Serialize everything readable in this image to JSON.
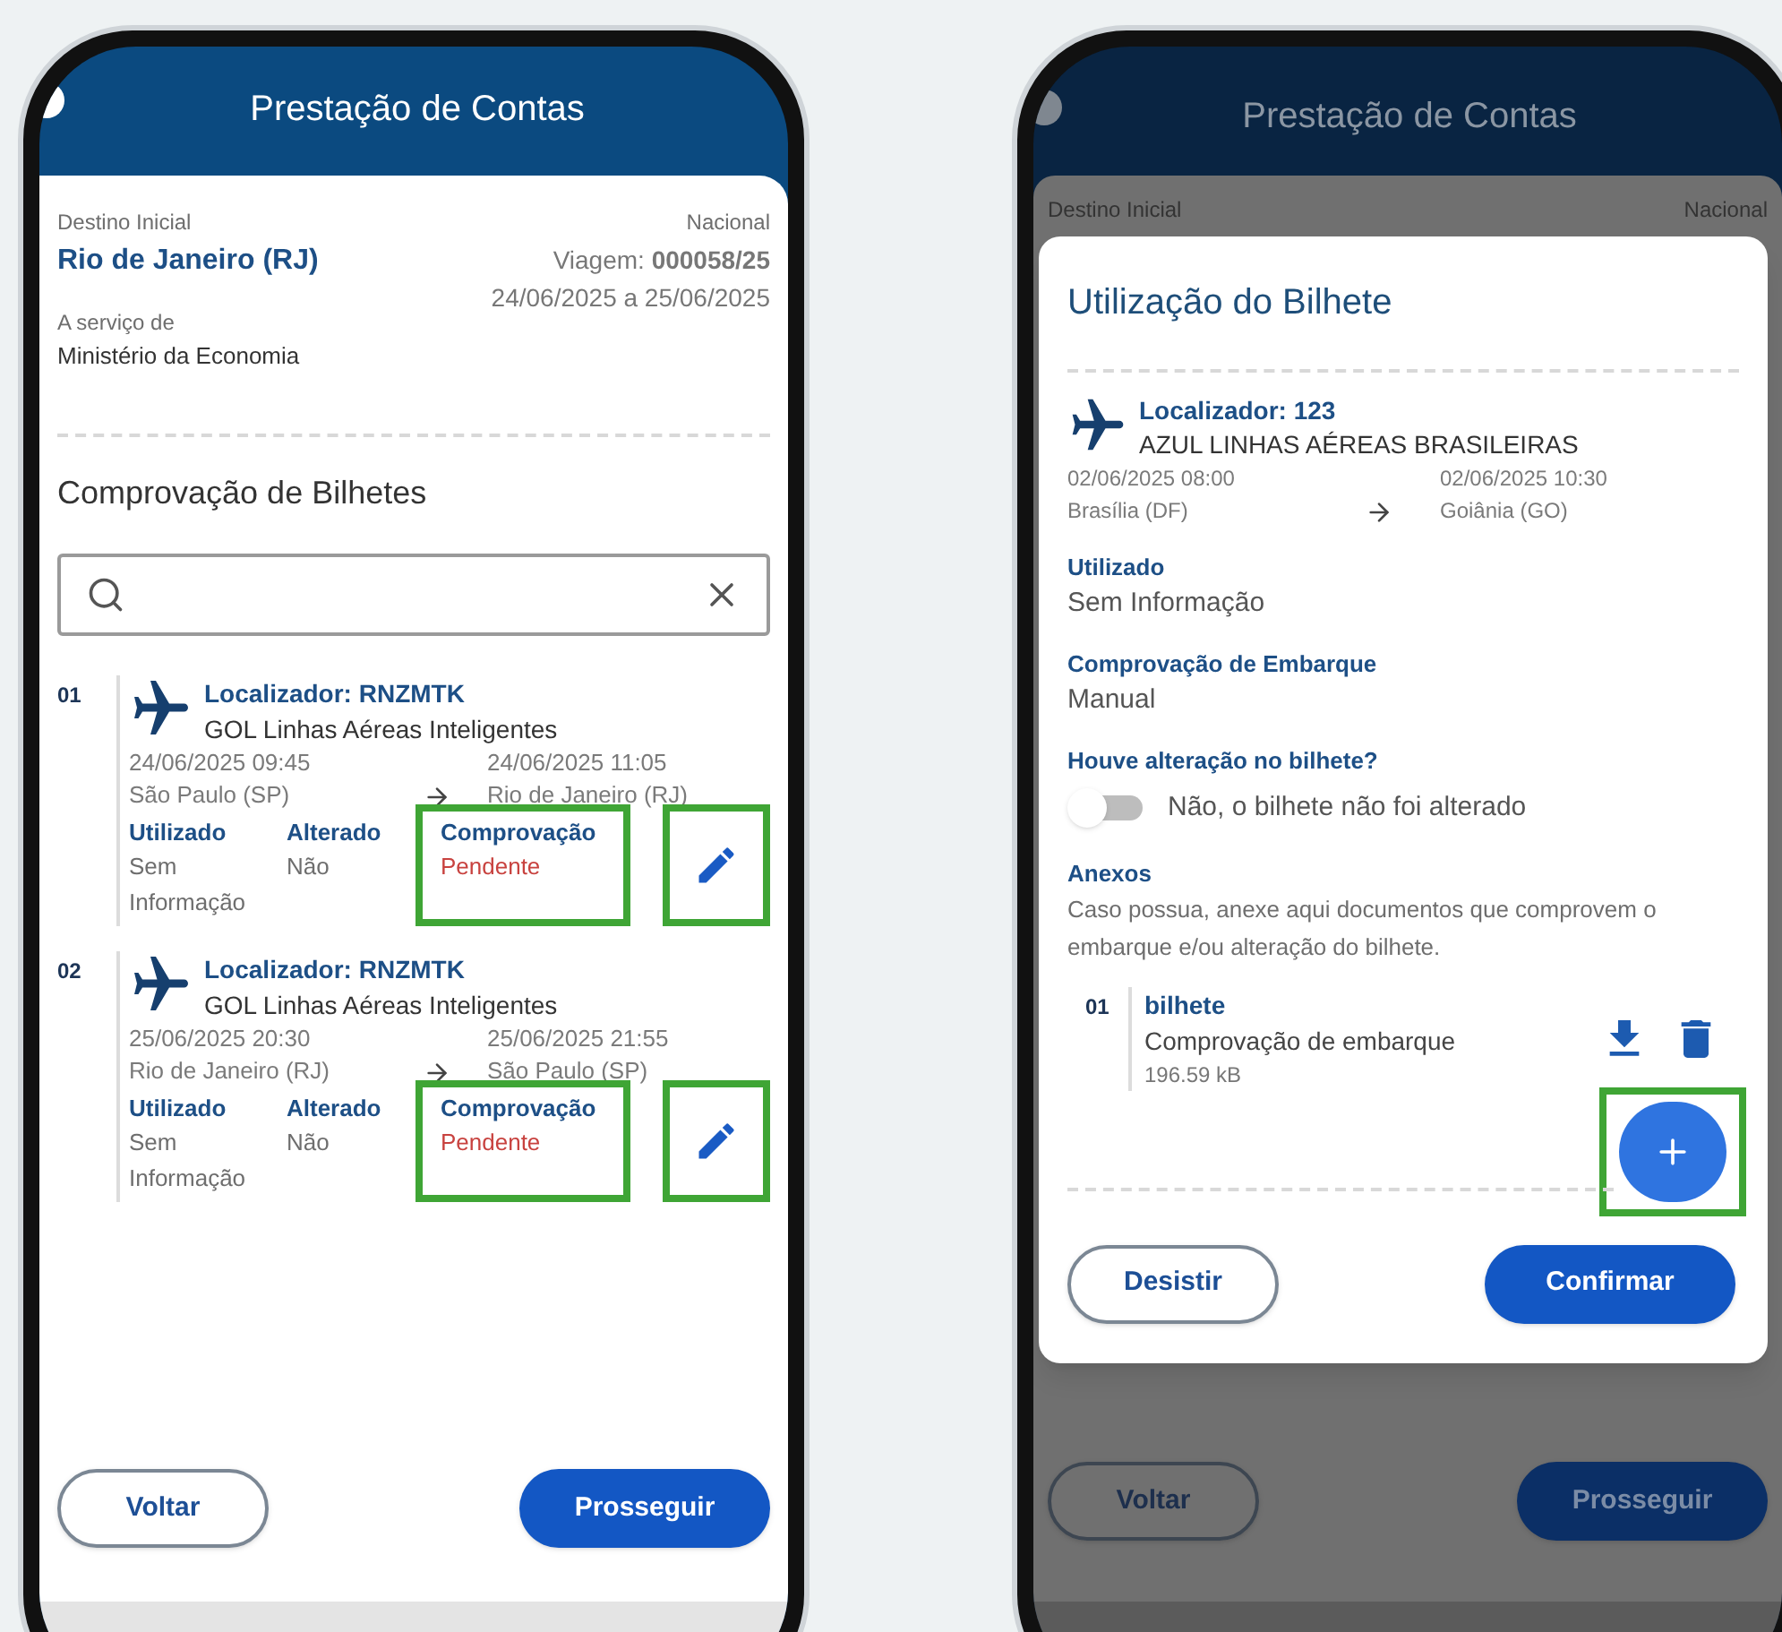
{
  "left_screen": {
    "header_title": "Prestação de Contas",
    "trip": {
      "destination_label": "Destino Inicial",
      "destination": "Rio de Janeiro (RJ)",
      "scope": "Nacional",
      "trip_number": "Viagem: **000058/25**",
      "dates": "24/06/2025 a 25/06/2025",
      "service_label": "A serviço de",
      "service": "Ministério da Economia"
    },
    "section_title": "Comprovação de Bilhetes",
    "tickets": [
      {
        "number": "01",
        "locator": "Localizador: RNZMTK",
        "airline": "GOL Linhas Aéreas Inteligentes",
        "departure": {
          "date": "24/06/2025",
          "time": "09:45",
          "city": "São Paulo (SP)"
        },
        "arrival": {
          "date": "24/06/2025",
          "time": "11:05",
          "city": "Rio de Janeiro (RJ)"
        },
        "columns": [
          {
            "label": "Utilizado",
            "value": "Sem Informação",
            "color": "#6e6e6e",
            "highlighted": false
          },
          {
            "label": "Alterado",
            "value": "Não",
            "color": "#6e6e6e",
            "highlighted": false
          },
          {
            "label": "Comprovação",
            "value": "Pendente",
            "color": "#c8423f",
            "highlighted": true
          }
        ],
        "edit_highlighted": true
      },
      {
        "number": "02",
        "locator": "Localizador: RNZMTK",
        "airline": "GOL Linhas Aéreas Inteligentes",
        "departure": {
          "date": "25/06/2025",
          "time": "20:30",
          "city": "Rio de Janeiro (RJ)"
        },
        "arrival": {
          "date": "25/06/2025",
          "time": "21:55",
          "city": "São Paulo (SP)"
        },
        "columns": [
          {
            "label": "Utilizado",
            "value": "Sem Informação",
            "color": "#6e6e6e",
            "highlighted": false
          },
          {
            "label": "Alterado",
            "value": "Não",
            "color": "#6e6e6e",
            "highlighted": false
          },
          {
            "label": "Comprovação",
            "value": "Pendente",
            "color": "#c8423f",
            "highlighted": true
          }
        ],
        "edit_highlighted": true
      }
    ],
    "buttons": [
      {
        "label": "Voltar",
        "kind": "outline"
      },
      {
        "label": "Prosseguir",
        "kind": "primary"
      }
    ]
  },
  "right_screen": {
    "header_title": "Prestação de Contas",
    "background_labels": [
      "Destino Inicial",
      "Nacional"
    ],
    "modal": {
      "title": "Utilização do Bilhete",
      "ticket": {
        "locator": "Localizador: 123",
        "airline": "AZUL LINHAS AÉREAS BRASILEIRAS",
        "departure": {
          "date": "02/06/2025",
          "time": "08:00",
          "city": "Brasília (DF)"
        },
        "arrival": {
          "date": "02/06/2025",
          "time": "10:30",
          "city": "Goiânia (GO)"
        }
      },
      "fields": [
        {
          "label": "Utilizado",
          "value": "Sem Informação"
        },
        {
          "label": "Comprovação de Embarque",
          "value": "Manual"
        }
      ],
      "change": {
        "label": "Houve alteração no bilhete?",
        "on": false,
        "text": "Não, o bilhete não foi alterado"
      },
      "attachments": {
        "label": "Anexos",
        "description": "Caso possua, anexe aqui documentos que comprovem o embarque e/ou alteração do bilhete.",
        "items": [
          {
            "number": "01",
            "name": "bilhete",
            "type": "Comprovação de embarque",
            "size": "196.59 kB"
          }
        ]
      },
      "add_highlighted": true,
      "buttons": [
        {
          "label": "Desistir",
          "kind": "outline"
        },
        {
          "label": "Confirmar",
          "kind": "primary"
        }
      ]
    },
    "buttons": [
      {
        "label": "Voltar",
        "kind": "outline"
      },
      {
        "label": "Prosseguir",
        "kind": "primary"
      }
    ]
  }
}
